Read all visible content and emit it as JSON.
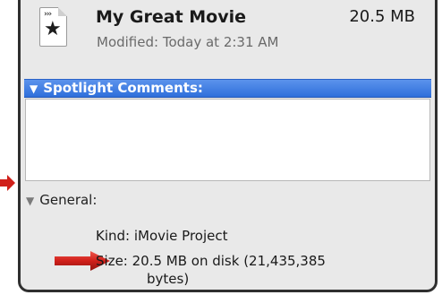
{
  "header": {
    "file_name": "My Great Movie",
    "file_size": "20.5 MB",
    "modified": "Modified: Today at 2:31 AM"
  },
  "icon": {
    "film_glyph": "›››",
    "star_glyph": "★",
    "semantic": "imovie-project-file-icon"
  },
  "spotlight": {
    "label": "Spotlight Comments:",
    "triangle": "▼",
    "comments": ""
  },
  "general": {
    "label": "General:",
    "triangle": "▼",
    "kind": "Kind: iMovie Project",
    "size_line1": "Size: 20.5 MB on disk (21,435,385",
    "size_line2": "bytes)"
  },
  "colors": {
    "accent_bar": "#3a78e0",
    "arrow_red": "#d0201a",
    "panel_bg": "#e9e9e9"
  }
}
